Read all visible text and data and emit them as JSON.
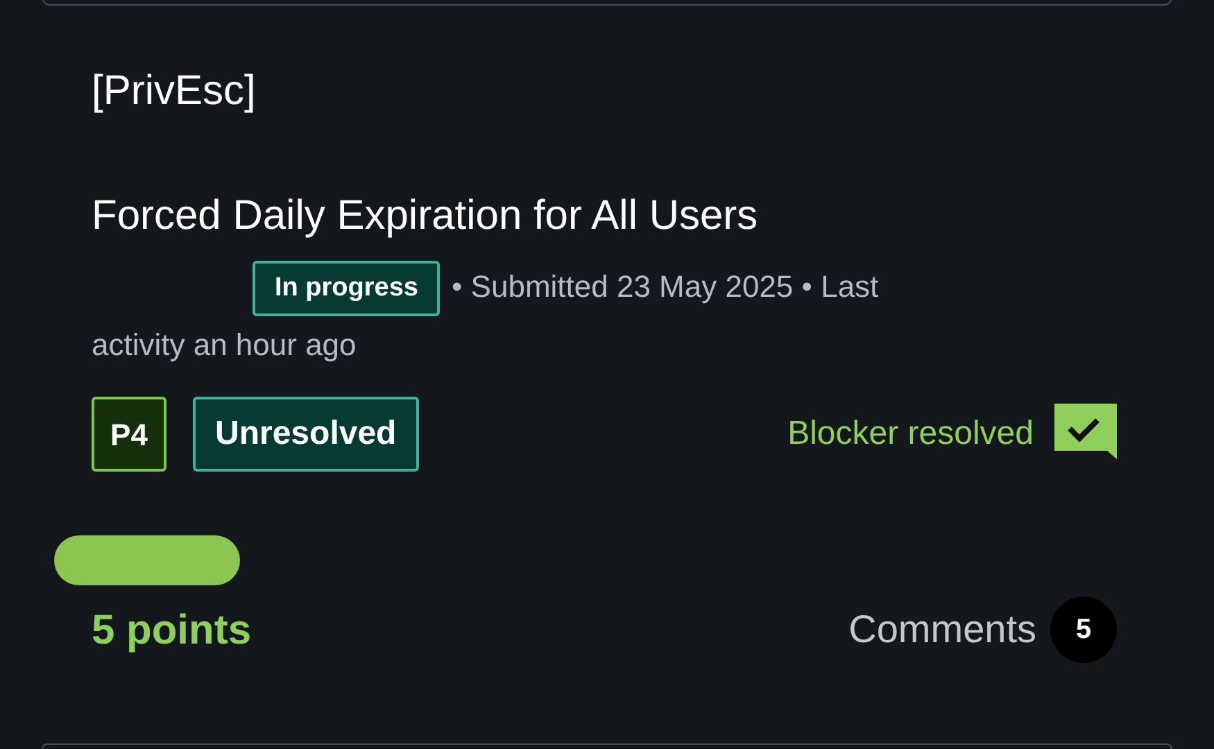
{
  "category": "[PrivEsc]",
  "title": "Forced Daily Expiration for All Users",
  "status": {
    "label": "In progress",
    "kind": "progress"
  },
  "meta": [
    "• Submitted 23 May 2025 • Last",
    "activity an hour ago"
  ],
  "priority": "P4",
  "resolution": "Unresolved",
  "blocker": {
    "label": "Blocker resolved",
    "resolved": true
  },
  "points": "5 points",
  "comments": {
    "label": "Comments",
    "count": "5"
  }
}
